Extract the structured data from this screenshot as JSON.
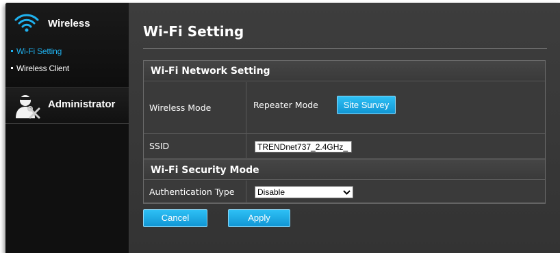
{
  "sidebar": {
    "wireless_title": "Wireless",
    "wireless_icon": "wifi-icon",
    "items": [
      {
        "label": "Wi-Fi Setting",
        "active": true
      },
      {
        "label": "Wireless Client",
        "active": false
      }
    ],
    "admin_title": "Administrator",
    "admin_icon": "admin-user-icon"
  },
  "main": {
    "title": "Wi-Fi Setting",
    "network_section": {
      "header": "Wi-Fi Network Setting",
      "wireless_mode_label": "Wireless Mode",
      "wireless_mode_value": "Repeater Mode",
      "site_survey_label": "Site Survey",
      "ssid_label": "SSID",
      "ssid_value": "TRENDnet737_2.4GHz_"
    },
    "security_section": {
      "header": "Wi-Fi Security Mode",
      "auth_label": "Authentication Type",
      "auth_value": "Disable"
    },
    "buttons": {
      "cancel": "Cancel",
      "apply": "Apply"
    }
  },
  "colors": {
    "accent": "#1fb1ee",
    "button": "#1aa6e2",
    "sidebar_bg": "#101010",
    "main_bg": "#3b3b3b"
  }
}
